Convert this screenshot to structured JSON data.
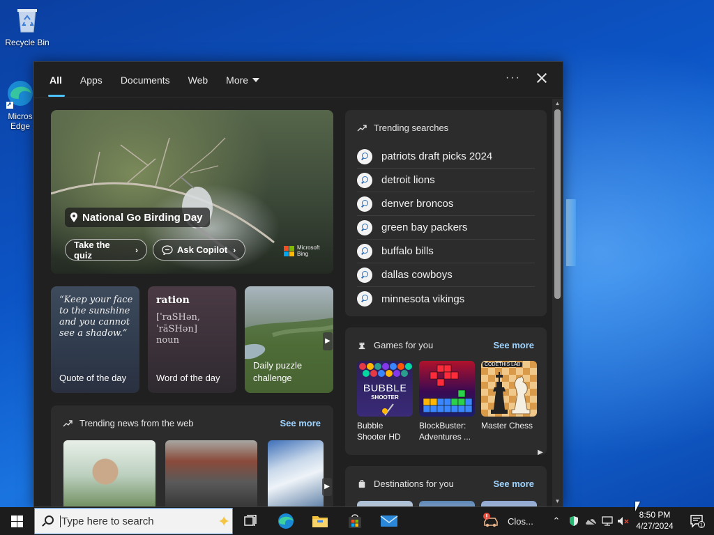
{
  "desktop": {
    "icons": [
      {
        "label": "Recycle Bin",
        "icon": "recycle-bin-icon"
      },
      {
        "label": "Micros\nEdge",
        "icon": "edge-icon"
      }
    ]
  },
  "search_panel": {
    "tabs": [
      {
        "label": "All",
        "active": true
      },
      {
        "label": "Apps"
      },
      {
        "label": "Documents"
      },
      {
        "label": "Web"
      },
      {
        "label": "More"
      }
    ],
    "more_options_label": "···",
    "hero": {
      "title": "National Go Birding Day",
      "quiz_button": "Take the quiz",
      "copilot_button": "Ask Copilot",
      "brand_line1": "Microsoft",
      "brand_line2": "Bing"
    },
    "cards": {
      "quote": {
        "text": "“Keep your face to the sunshine and you cannot see a shadow.”",
        "label": "Quote of the day"
      },
      "word": {
        "word": "ration",
        "phonetic": "[ˈraSHən, ˈrāSHən]",
        "pos": "noun",
        "label": "Word of the day"
      },
      "puzzle": {
        "label": "Daily puzzle challenge"
      }
    },
    "trending_news": {
      "title": "Trending news from the web",
      "see_more": "See more"
    },
    "trending_searches": {
      "title": "Trending searches",
      "items": [
        "patriots draft picks 2024",
        "detroit lions",
        "denver broncos",
        "green bay packers",
        "buffalo bills",
        "dallas cowboys",
        "minnesota vikings"
      ]
    },
    "games": {
      "title": "Games for you",
      "see_more": "See more",
      "items": [
        {
          "name": "Bubble Shooter HD"
        },
        {
          "name": "BlockBuster: Adventures ..."
        },
        {
          "name": "Master Chess"
        }
      ],
      "bubble_logo_line1": "BUBBLE",
      "bubble_logo_line2": "SHOOTER",
      "chess_brand": "CODETHIS LAB"
    },
    "destinations": {
      "title": "Destinations for you",
      "see_more": "See more"
    }
  },
  "taskbar": {
    "search_placeholder": "Type here to search",
    "running_app_label": "Clos...",
    "clock_time": "8:50 PM",
    "clock_date": "4/27/2024",
    "notification_count": "1"
  },
  "colors": {
    "accent": "#4cc2ff",
    "link": "#9fd4ff",
    "panel_bg": "#202020",
    "card_bg": "#2c2c2c",
    "taskbar_bg": "#1c1c1c"
  }
}
